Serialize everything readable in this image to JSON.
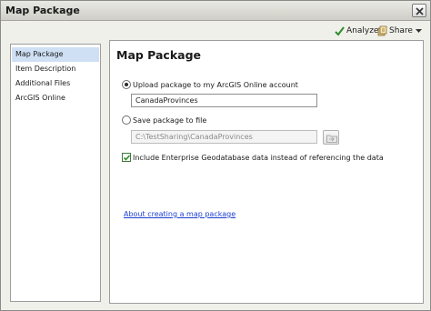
{
  "window": {
    "title": "Map Package"
  },
  "toolbar": {
    "analyze_label": "Analyze",
    "share_label": "Share"
  },
  "sidebar": {
    "items": [
      {
        "label": "Map Package",
        "selected": true
      },
      {
        "label": "Item Description",
        "selected": false
      },
      {
        "label": "Additional Files",
        "selected": false
      },
      {
        "label": "ArcGIS Online",
        "selected": false
      }
    ]
  },
  "main": {
    "title": "Map Package",
    "upload_option": {
      "label": "Upload package to my ArcGIS Online account",
      "selected": true,
      "value": "CanadaProvinces"
    },
    "save_option": {
      "label": "Save package to file",
      "selected": false,
      "value": "C:\\TestSharing\\CanadaProvinces"
    },
    "enterprise_checkbox": {
      "label": "Include Enterprise Geodatabase data instead of referencing the data",
      "checked": true
    },
    "help_link": "About creating a map package"
  },
  "colors": {
    "selection": "#cfe0f4",
    "link": "#1d3fd1",
    "check": "#2e8b2e"
  },
  "icons": {
    "close": "close-icon",
    "analyze": "checkmark-icon",
    "share": "share-icon",
    "browse": "folder-icon",
    "checkbox": "checkmark-icon"
  }
}
